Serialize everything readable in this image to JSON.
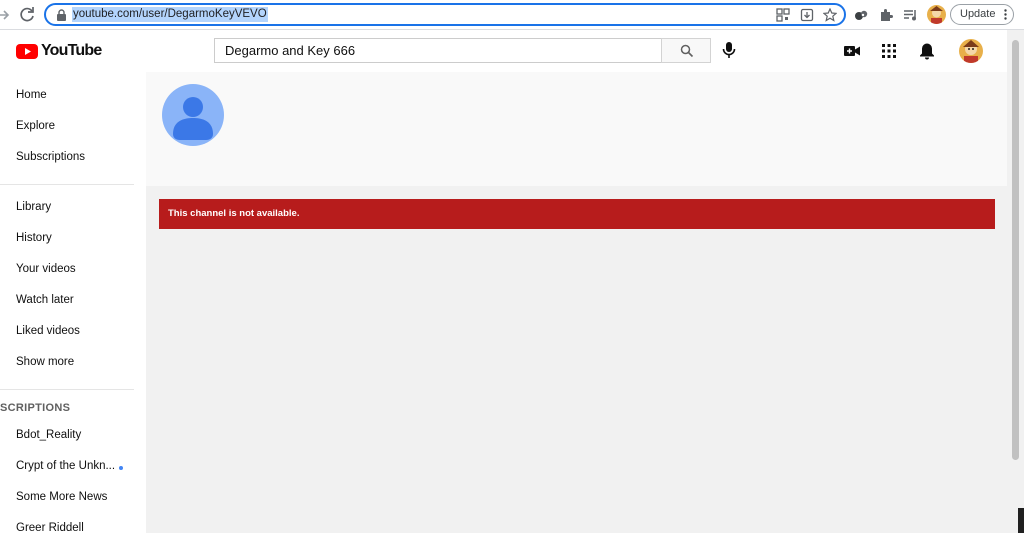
{
  "browser": {
    "url": "youtube.com/user/DegarmoKeyVEVO",
    "update_label": "Update"
  },
  "masthead": {
    "logo_text": "YouTube",
    "search_value": "Degarmo and Key 666",
    "icons": [
      "search-icon",
      "microphone-icon",
      "create-video-icon",
      "apps-grid-icon",
      "notifications-bell-icon"
    ]
  },
  "sidebar": {
    "main": [
      {
        "label": "Home"
      },
      {
        "label": "Explore"
      },
      {
        "label": "Subscriptions"
      }
    ],
    "library": [
      {
        "label": "Library"
      },
      {
        "label": "History"
      },
      {
        "label": "Your videos"
      },
      {
        "label": "Watch later"
      },
      {
        "label": "Liked videos"
      },
      {
        "label": "Show more"
      }
    ],
    "subscriptions_heading": "SCRIPTIONS",
    "subscriptions": [
      {
        "label": "Bdot_Reality"
      },
      {
        "label": "Crypt of the Unkn..."
      },
      {
        "label": "Some More News"
      },
      {
        "label": "Greer Riddell"
      }
    ]
  },
  "channel": {
    "error_message": "This channel is not available."
  },
  "colors": {
    "accent": "#1a73e8",
    "error_bg": "#b71c1c",
    "content_bg": "#f1f1f1",
    "avatar_bg": "#8ab4f8",
    "avatar_figure": "#3b78e7",
    "youtube_red": "#ff0000"
  }
}
